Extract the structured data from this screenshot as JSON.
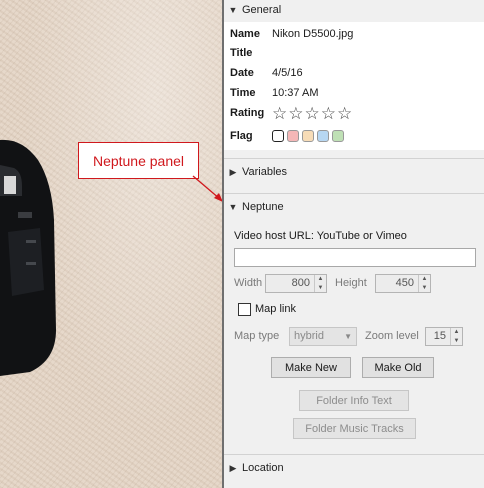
{
  "annotation": {
    "text": "Neptune panel"
  },
  "general": {
    "header": "General",
    "name_label": "Name",
    "name_value": "Nikon D5500.jpg",
    "title_label": "Title",
    "title_value": "",
    "date_label": "Date",
    "date_value": "4/5/16",
    "time_label": "Time",
    "time_value": "10:37 AM",
    "rating_label": "Rating",
    "rating_stars": 5,
    "rating_value": 0,
    "flag_label": "Flag",
    "flag_colors": [
      "#ffffff",
      "#f5b7b7",
      "#f7dcb7",
      "#b7d7f2",
      "#bfe0b5"
    ]
  },
  "variables": {
    "header": "Variables"
  },
  "neptune": {
    "header": "Neptune",
    "video_label": "Video host URL: YouTube or Vimeo",
    "video_value": "",
    "width_label": "Width",
    "width_value": "800",
    "height_label": "Height",
    "height_value": "450",
    "map_link_label": "Map link",
    "map_type_label": "Map type",
    "map_type_value": "hybrid",
    "zoom_label": "Zoom level",
    "zoom_value": "15",
    "make_new_label": "Make New",
    "make_old_label": "Make Old",
    "folder_info_label": "Folder Info Text",
    "folder_music_label": "Folder Music Tracks"
  },
  "location": {
    "header": "Location"
  },
  "icons": {
    "expanded": "triangle-down-icon",
    "collapsed": "triangle-right-icon",
    "star": "star-outline-icon",
    "spin": "spin-arrows-icon",
    "dropdown": "chevron-down-icon"
  },
  "colors": {
    "annotation": "#d0181d",
    "panel_bg": "#f0f0f0",
    "table_bg": "#ffffff"
  }
}
